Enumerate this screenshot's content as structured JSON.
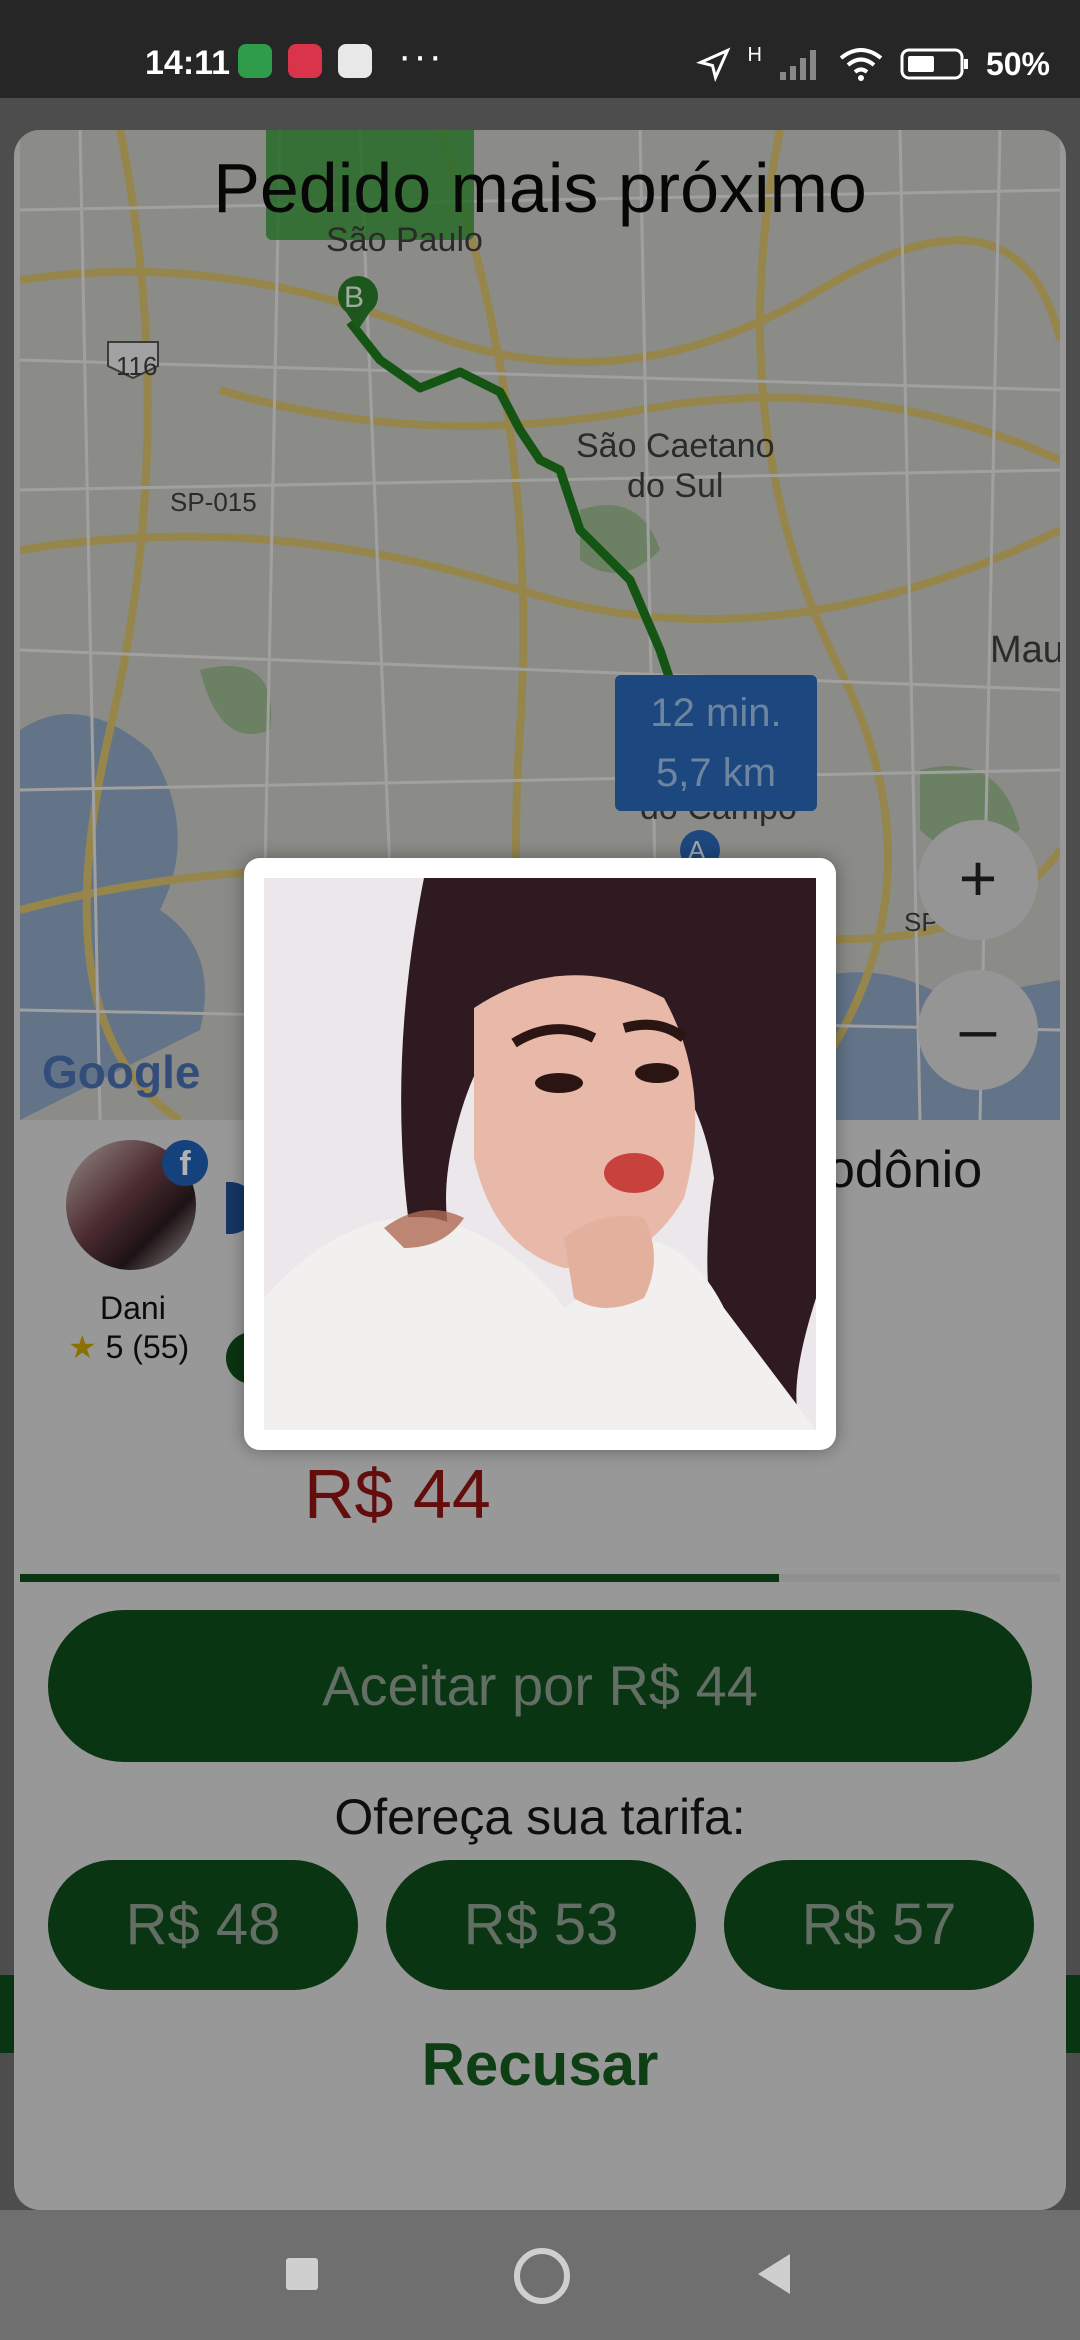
{
  "status_bar": {
    "time": "14:11",
    "more_indicator": "···",
    "network_type": "H",
    "battery_percent": "50%"
  },
  "sheet": {
    "title": "Pedido mais próximo"
  },
  "map": {
    "labels": {
      "sao_paulo": "São Paulo",
      "sao_caetano": "São Caetano\ndo Sul",
      "mau": "Mau",
      "sp015": "SP-015",
      "road116": "116",
      "campo": "do Campo",
      "sp_right": "SP-"
    },
    "marker_b": "B",
    "marker_a": "A",
    "route_badge": {
      "time": "12 min.",
      "distance": "5,7 km"
    },
    "zoom_in": "+",
    "zoom_out": "–",
    "attribution": "Google"
  },
  "driver": {
    "name": "Dani",
    "rating_star": "★",
    "rating": "5 (55)"
  },
  "destination_fragment": "odônio",
  "price": "R$ 44",
  "timer_progress": 0.73,
  "actions": {
    "accept": "Aceitar por R$ 44",
    "offer_label": "Ofereça sua tarifa:",
    "fares": [
      "R$ 48",
      "R$ 53",
      "R$ 57"
    ],
    "decline": "Recusar"
  },
  "colors": {
    "primary_green": "#0f4d1a",
    "price_red": "#8e1414",
    "route_blue": "#2968b6"
  }
}
